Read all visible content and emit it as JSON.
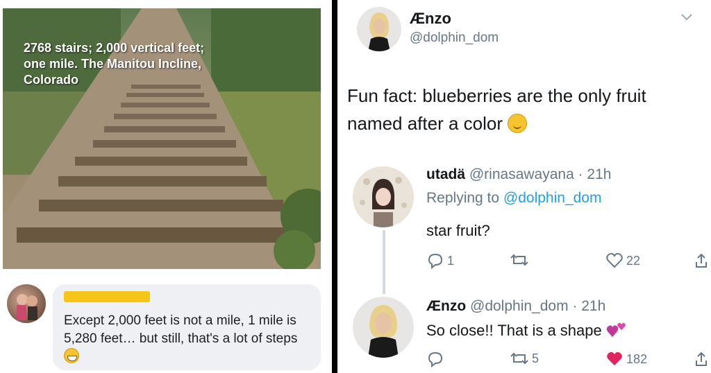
{
  "left_post": {
    "photo_caption": "2768 stairs; 2,000 vertical feet;\none mile.  The Manitou Incline,\nColorado",
    "comment": {
      "text_before_emoji": "Except 2,000 feet is not a mile, 1 mile is 5,280 feet… but still, that's a lot of steps",
      "emoji": "grinning-face-icon"
    },
    "redaction_color": "#f5c518"
  },
  "tweet": {
    "author_name": "Ænzo",
    "author_handle": "@dolphin_dom",
    "text": "Fun fact: blueberries are the only fruit named after a color",
    "emoji": "hugging-face-icon"
  },
  "reply1": {
    "name": "utadä",
    "handle_time": "@rinasawayana · 21h",
    "replying_label": "Replying to ",
    "replying_mention": "@dolphin_dom",
    "text": "star fruit?",
    "reply_count": "1",
    "retweet_count": "",
    "like_count": "22"
  },
  "reply2": {
    "name": "Ænzo",
    "handle_time": "@dolphin_dom · 21h",
    "text": "So close!! That is a shape",
    "emoji": "two-hearts-icon",
    "retweet_count": "5",
    "like_count": "182"
  },
  "colors": {
    "accent_blue": "#1da1f2",
    "muted_gray": "#657786",
    "like_red": "#e0245e",
    "divider": "#000000"
  }
}
